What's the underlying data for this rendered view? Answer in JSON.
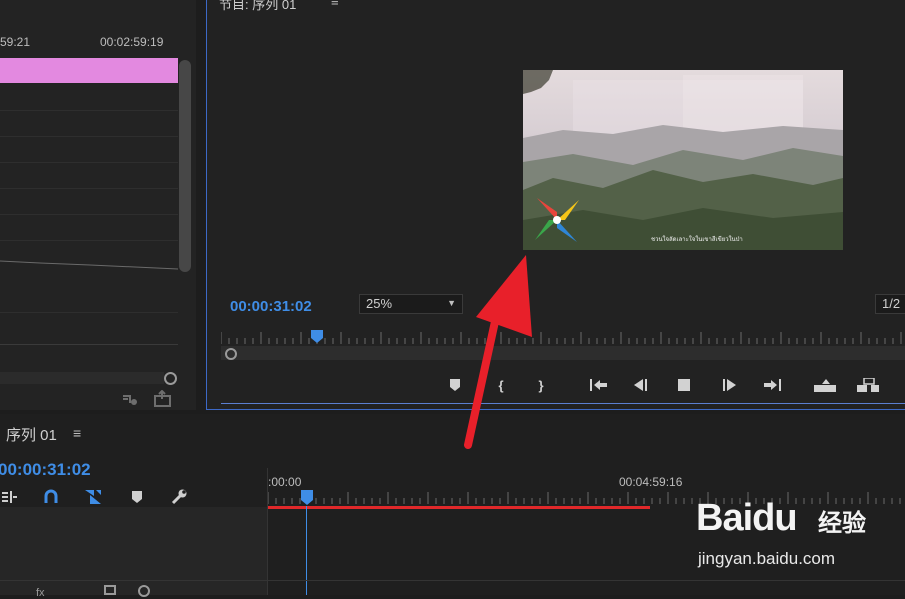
{
  "source_panel": {
    "time_left": "59:21",
    "time_right": "00:02:59:19"
  },
  "program_monitor": {
    "title": "节目: 序列 01",
    "menu_icon": "hamburger-icon",
    "current_timecode": "00:00:31:02",
    "zoom": "25%",
    "resolution": "1/2",
    "video_caption": "ชวนใจลัดเลาะใจในเขาสีเขียวในป่า",
    "playhead_color": "#3f8de6"
  },
  "timeline": {
    "tab_label": "序列 01",
    "menu_icon": "hamburger-icon",
    "timecode": "00:00:31:02",
    "ruler_start": ":00:00",
    "ruler_mark": "00:04:59:16",
    "work_area_color": "#e0282a"
  },
  "watermark": {
    "brand": "Baidu",
    "product": "经验",
    "url": "jingyan.baidu.com"
  },
  "colors": {
    "accent_blue": "#3f8de6",
    "clip_pink": "#e389e0",
    "panel_border": "#3d69c7",
    "arrow_red": "#e8202a"
  }
}
